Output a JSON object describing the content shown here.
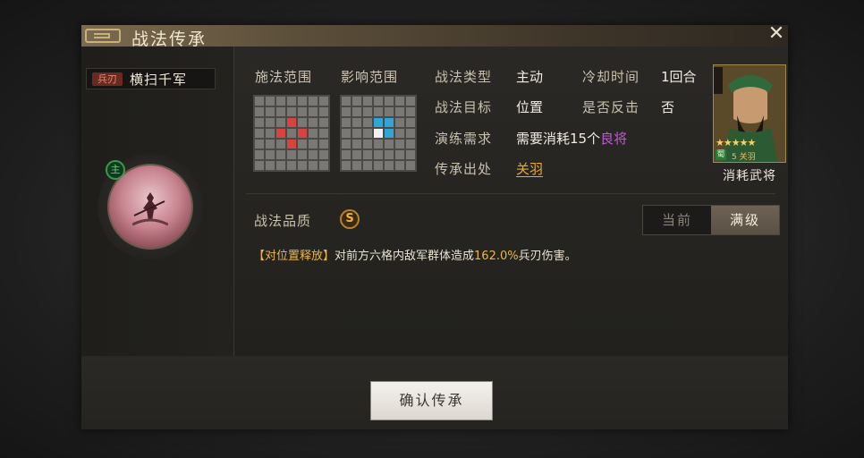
{
  "window": {
    "title": "战法传承"
  },
  "skill": {
    "type_badge": "兵刃",
    "name": "横扫千军",
    "main_badge": "主"
  },
  "ranges": {
    "cast_label": "施法范围",
    "effect_label": "影响范围"
  },
  "info": {
    "type_label": "战法类型",
    "type_value": "主动",
    "cooldown_label": "冷却时间",
    "cooldown_value": "1回合",
    "target_label": "战法目标",
    "target_value": "位置",
    "counter_label": "是否反击",
    "counter_value": "否",
    "training_label": "演练需求",
    "training_prefix": "需要消耗15个",
    "training_highlight": "良将",
    "source_label": "传承出处",
    "source_value": "关羽"
  },
  "hero_card": {
    "caption": "消耗武将",
    "stars": "★★★★★",
    "faction": "蜀",
    "small_text": "5  关羽"
  },
  "quality": {
    "label": "战法品质",
    "grade": "S"
  },
  "level_toggle": {
    "current": "当前",
    "max": "满级",
    "selected": "满级"
  },
  "description": {
    "tag": "【对位置释放】",
    "prefix": "对前方六格内敌军群体造成",
    "value": "162.0%",
    "suffix": "兵刃伤害。"
  },
  "actions": {
    "confirm_label": "确认传承"
  },
  "colors": {
    "accent_gold": "#e8a93a",
    "purple": "#c45ad8",
    "red_cell": "#d9433f",
    "blue_cell": "#2ea7d8"
  }
}
